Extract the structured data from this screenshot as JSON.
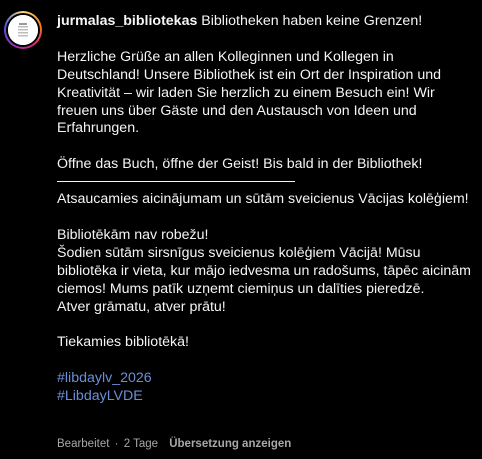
{
  "post": {
    "username": "jurmalas_bibliotekas",
    "paragraphs": {
      "de_headline": " Bibliotheken haben keine Grenzen!",
      "de_body_1": "Herzliche Grüße an allen Kolleginnen und Kollegen in Deutschland! Unsere Bibliothek ist ein Ort der Inspiration und Kreativität – wir laden Sie herzlich zu einem Besuch ein! Wir freuen uns über Gäste und den Austausch von Ideen und Erfahrungen.",
      "de_body_2": "Öffne das Buch, öffne der Geist! Bis bald in der Bibliothek!",
      "lv_intro": "Atsaucamies aicinājumam un sūtām sveicienus Vācijas kolēģiem!",
      "lv_headline": "Bibliotēkām nav robežu!",
      "lv_body_1": "Šodien sūtām sirsnīgus sveicienus kolēģiem Vācijā! Mūsu bibliotēka ir vieta, kur mājo iedvesma un radošums, tāpēc aicinām ciemos! Mums patīk uzņemt ciemiņus un dalīties pieredzē.",
      "lv_body_2": "Atver grāmatu, atver prātu!",
      "lv_closing": "Tiekamies bibliotēkā!"
    },
    "hashtags": [
      "#libdaylv_2026",
      "#LibdayLVDE"
    ],
    "meta": {
      "edited_label": "Bearbeitet",
      "separator": "·",
      "age": "2 Tage",
      "translate_label": "Übersetzung anzeigen"
    }
  },
  "colors": {
    "background": "#000000",
    "text": "#f5f5f5",
    "hashtag": "#6b8fd6",
    "meta": "#a8a8a8"
  },
  "icons": {
    "avatar": "library-logo-avatar"
  }
}
